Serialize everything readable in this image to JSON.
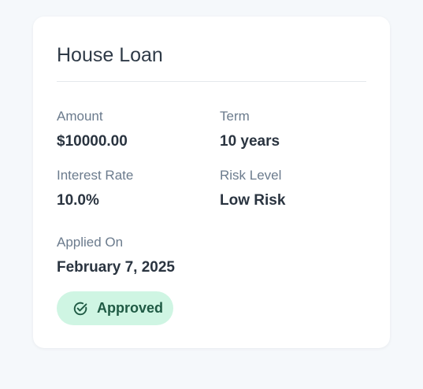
{
  "loan": {
    "title": "House Loan",
    "amount_label": "Amount",
    "amount_value": "$10000.00",
    "term_label": "Term",
    "term_value": "10 years",
    "interest_label": "Interest Rate",
    "interest_value": "10.0%",
    "risk_label": "Risk Level",
    "risk_value": "Low Risk",
    "applied_label": "Applied On",
    "applied_value": "February 7, 2025",
    "status": {
      "label": "Approved",
      "icon": "check-circle-icon",
      "bg_color": "#cff5e3",
      "text_color": "#1f5a44"
    }
  }
}
